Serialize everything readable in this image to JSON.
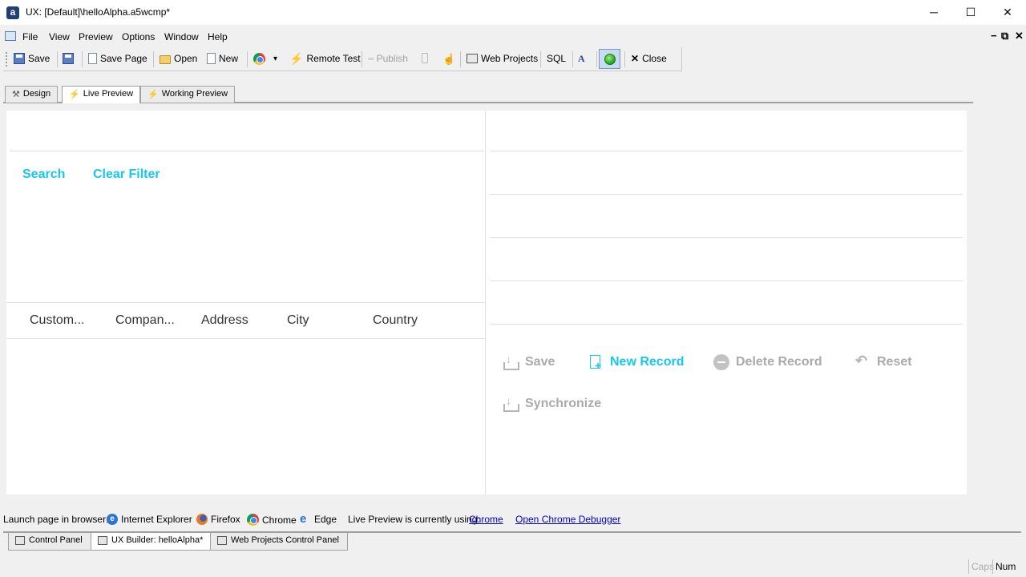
{
  "window": {
    "title": "UX: [Default]\\helloAlpha.a5wcmp*",
    "app_icon_letter": "a",
    "minimize": "─",
    "maximize": "☐",
    "close": "✕"
  },
  "menu": {
    "items": [
      "File",
      "View",
      "Preview",
      "Options",
      "Window",
      "Help"
    ],
    "mdi_controls": [
      "−",
      "⧉",
      "✕"
    ]
  },
  "toolbar": {
    "save": "Save",
    "save_page": "Save Page",
    "open": "Open",
    "new": "New",
    "remote_test": "Remote Test",
    "publish": "Publish",
    "web_projects": "Web Projects",
    "sql": "SQL",
    "close": "Close",
    "dropdown_arrow": "▾"
  },
  "tabs": [
    {
      "label": "Design",
      "icon": "tools-icon"
    },
    {
      "label": "Live Preview",
      "icon": "lightning-icon",
      "active": true
    },
    {
      "label": "Working Preview",
      "icon": "lightning-icon"
    }
  ],
  "search_panel": {
    "search_label": "Search",
    "clear_filter_label": "Clear Filter"
  },
  "list": {
    "columns": [
      "Custom...",
      "Compan...",
      "Address",
      "City",
      "Country"
    ]
  },
  "detail": {
    "save": "Save",
    "new_record": "New Record",
    "delete_record": "Delete Record",
    "reset": "Reset",
    "synchronize": "Synchronize"
  },
  "launch": {
    "prefix": "Launch page in browser:",
    "internet_explorer": "Internet Explorer",
    "firefox": "Firefox",
    "chrome": "Chrome",
    "edge": "Edge",
    "status_text": "Live Preview is currently using:",
    "current_browser": "Chrome",
    "debugger_link": "Open Chrome Debugger"
  },
  "doc_tabs": [
    {
      "label": "Control Panel"
    },
    {
      "label": "UX Builder: helloAlpha*",
      "active": true
    },
    {
      "label": "Web Projects Control Panel"
    }
  ],
  "status": {
    "caps": "Caps",
    "num": "Num"
  },
  "colors": {
    "accent": "#16c7ef",
    "disabled_text": "#aaaaaa"
  }
}
